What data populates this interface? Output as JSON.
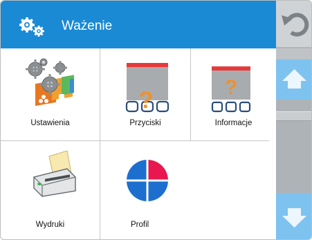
{
  "header": {
    "title": "Ważenie",
    "icon": "gears-icon",
    "color": "#1a8ad4"
  },
  "right_panel": {
    "undo_icon": "undo-arrow-icon",
    "scroll_up_icon": "arrow-up-icon",
    "scroll_down_icon": "arrow-down-icon"
  },
  "tiles": [
    {
      "label": "Ustawienia",
      "icon": "settings-gears-icon"
    },
    {
      "label": "Przyciski",
      "icon": "buttons-question-icon"
    },
    {
      "label": "Informacje",
      "icon": "info-question-icon"
    },
    {
      "label": "Wydruki",
      "icon": "printer-icon"
    },
    {
      "label": "Profil",
      "icon": "profile-pie-icon"
    },
    {
      "label": "",
      "icon": ""
    }
  ],
  "colors": {
    "scroll_button": "#7ec3f0",
    "panel_gray": "#bfc3c6",
    "question_orange": "#f0912a",
    "red_bar": "#e63a3a",
    "pie_red": "#e8174f",
    "pie_blue": "#1d6fcf"
  }
}
